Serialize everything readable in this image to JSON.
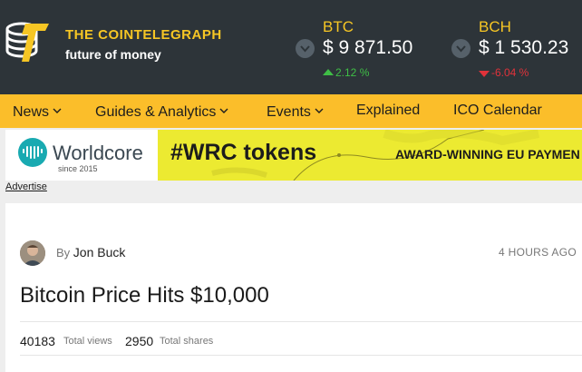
{
  "site": {
    "name": "THE COINTELEGRAPH",
    "tagline": "future of money",
    "brand_color": "#f6c624",
    "header_bg": "#2d3439"
  },
  "tickers": [
    {
      "symbol": "BTC",
      "price": "$ 9 871.50",
      "change": "2.12 %",
      "direction": "up"
    },
    {
      "symbol": "BCH",
      "price": "$ 1 530.23",
      "change": "-6.04 %",
      "direction": "down"
    }
  ],
  "colors": {
    "up": "#3fbe46",
    "down": "#e0323a",
    "nav_bg": "#fbbe2a"
  },
  "nav": {
    "items": [
      {
        "label": "News",
        "has_dropdown": true
      },
      {
        "label": "Guides & Analytics",
        "has_dropdown": true
      },
      {
        "label": "Events",
        "has_dropdown": true
      },
      {
        "label": "Explained",
        "has_dropdown": false
      },
      {
        "label": "ICO Calendar",
        "has_dropdown": false
      }
    ]
  },
  "ad": {
    "brand": "Worldcore",
    "since": "since 2015",
    "headline": "#WRC tokens",
    "subtext": "AWARD-WINNING EU PAYMEN",
    "advertise_link": "Advertise"
  },
  "article": {
    "by_label": "By",
    "author": "Jon Buck",
    "time_ago": "4 HOURS AGO",
    "title": "Bitcoin Price Hits $10,000",
    "views": "40183",
    "views_label": "Total views",
    "shares": "2950",
    "shares_label": "Total shares"
  }
}
